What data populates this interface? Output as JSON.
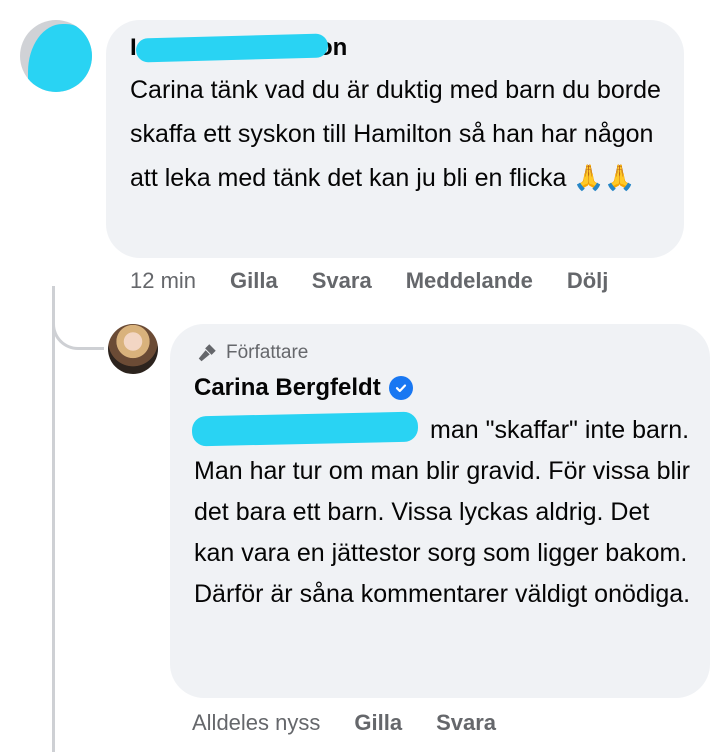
{
  "comment": {
    "author_first_visible": "I",
    "author_last_visible": "on",
    "text": "Carina tänk vad du är duktig med barn du borde skaffa ett syskon till Hamilton så han har någon att leka med tänk det kan ju bli en flicka 🙏🙏",
    "actions": {
      "time": "12 min",
      "like": "Gilla",
      "reply": "Svara",
      "message": "Meddelande",
      "hide": "Dölj"
    }
  },
  "reply": {
    "badge": "Författare",
    "author": "Carina Bergfeldt",
    "text": "man \"skaffar\" inte barn. Man har tur om man blir gravid. För vissa blir det bara ett barn. Vissa lyckas aldrig. Det kan vara en jättestor sorg som ligger bakom. Därför är såna kommentarer väldigt onödiga.",
    "actions": {
      "time": "Alldeles nyss",
      "like": "Gilla",
      "reply": "Svara"
    }
  },
  "colors": {
    "bubble": "#f0f2f5",
    "redaction": "#29d3f3",
    "meta_text": "#65676b",
    "verified": "#1877f2"
  },
  "icons": {
    "verified": "verified-badge-icon",
    "author_badge": "microphone-icon"
  }
}
